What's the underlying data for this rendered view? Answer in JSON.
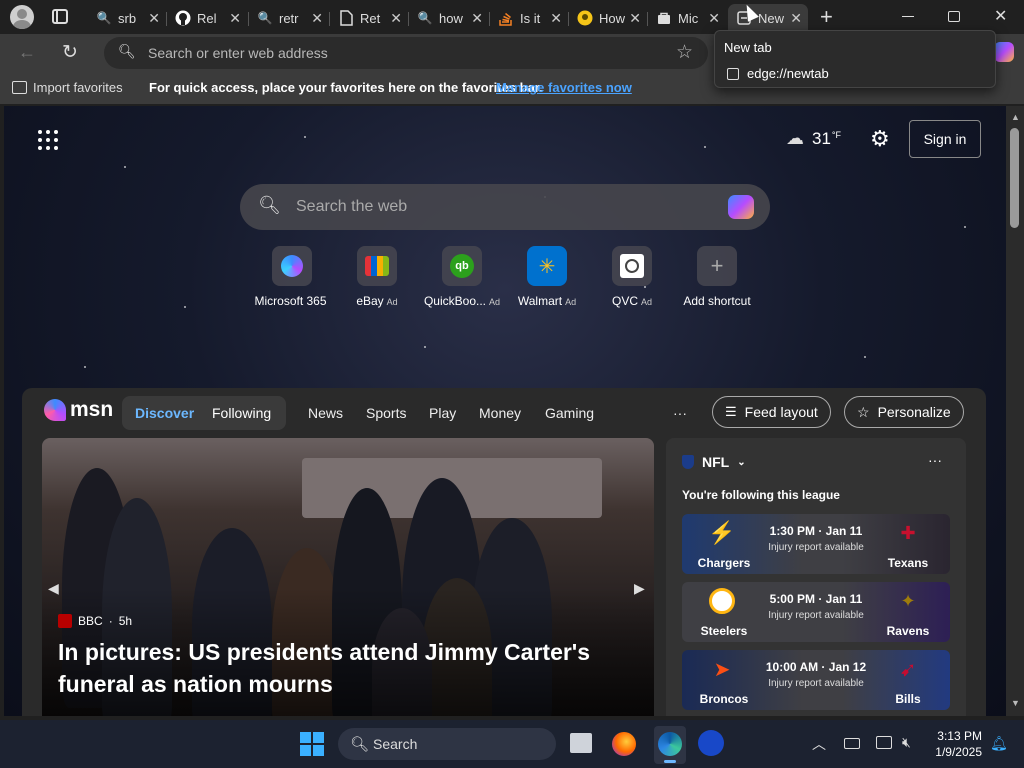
{
  "tabs": [
    {
      "label": "srb",
      "icon": "bing-search-icon"
    },
    {
      "label": "Rel",
      "icon": "github-icon"
    },
    {
      "label": "retr",
      "icon": "bing-search-icon"
    },
    {
      "label": "Ret",
      "icon": "document-icon"
    },
    {
      "label": "how",
      "icon": "bing-search-icon"
    },
    {
      "label": "Is it",
      "icon": "stackoverflow-icon"
    },
    {
      "label": "How",
      "icon": "lightbulb-icon"
    },
    {
      "label": "Mic",
      "icon": "store-icon"
    },
    {
      "label": "New",
      "icon": "new-tab-icon"
    }
  ],
  "tab_popup": {
    "title": "New tab",
    "url": "edge://newtab"
  },
  "address_bar": {
    "placeholder": "Search or enter web address"
  },
  "favorites_bar": {
    "import_label": "Import favorites",
    "message": "For quick access, place your favorites here on the favorites bar.",
    "manage_link": "Manage favorites now"
  },
  "newtab": {
    "weather": {
      "temp": "31",
      "unit": "°F"
    },
    "sign_in": "Sign in",
    "search_placeholder": "Search the web",
    "quick_links": [
      {
        "label": "Microsoft 365",
        "ad": ""
      },
      {
        "label": "eBay",
        "ad": "Ad"
      },
      {
        "label": "QuickBoo...",
        "ad": "Ad"
      },
      {
        "label": "Walmart",
        "ad": "Ad"
      },
      {
        "label": "QVC",
        "ad": "Ad"
      },
      {
        "label": "Add shortcut",
        "ad": ""
      }
    ]
  },
  "msn": {
    "logo_text": "msn",
    "toggle": [
      "Discover",
      "Following"
    ],
    "nav": [
      "News",
      "Sports",
      "Play",
      "Money",
      "Gaming"
    ],
    "more": "···",
    "feed_layout": "Feed layout",
    "personalize": "Personalize",
    "hero": {
      "source": "BBC",
      "age": "5h",
      "headline": "In pictures: US presidents attend Jimmy Carter's funeral as nation mourns"
    },
    "nfl": {
      "league": "NFL",
      "following": "You're following this league",
      "games": [
        {
          "away": "Chargers",
          "home": "Texans",
          "time": "1:30 PM · Jan 11",
          "note": "Injury report available"
        },
        {
          "away": "Steelers",
          "home": "Ravens",
          "time": "5:00 PM · Jan 11",
          "note": "Injury report available"
        },
        {
          "away": "Broncos",
          "home": "Bills",
          "time": "10:00 AM · Jan 12",
          "note": "Injury report available"
        }
      ]
    }
  },
  "taskbar": {
    "search_label": "Search",
    "time": "3:13 PM",
    "date": "1/9/2025"
  },
  "colors": {
    "accent_link": "#4aa3ff",
    "discover_active": "#6cb8ff"
  }
}
